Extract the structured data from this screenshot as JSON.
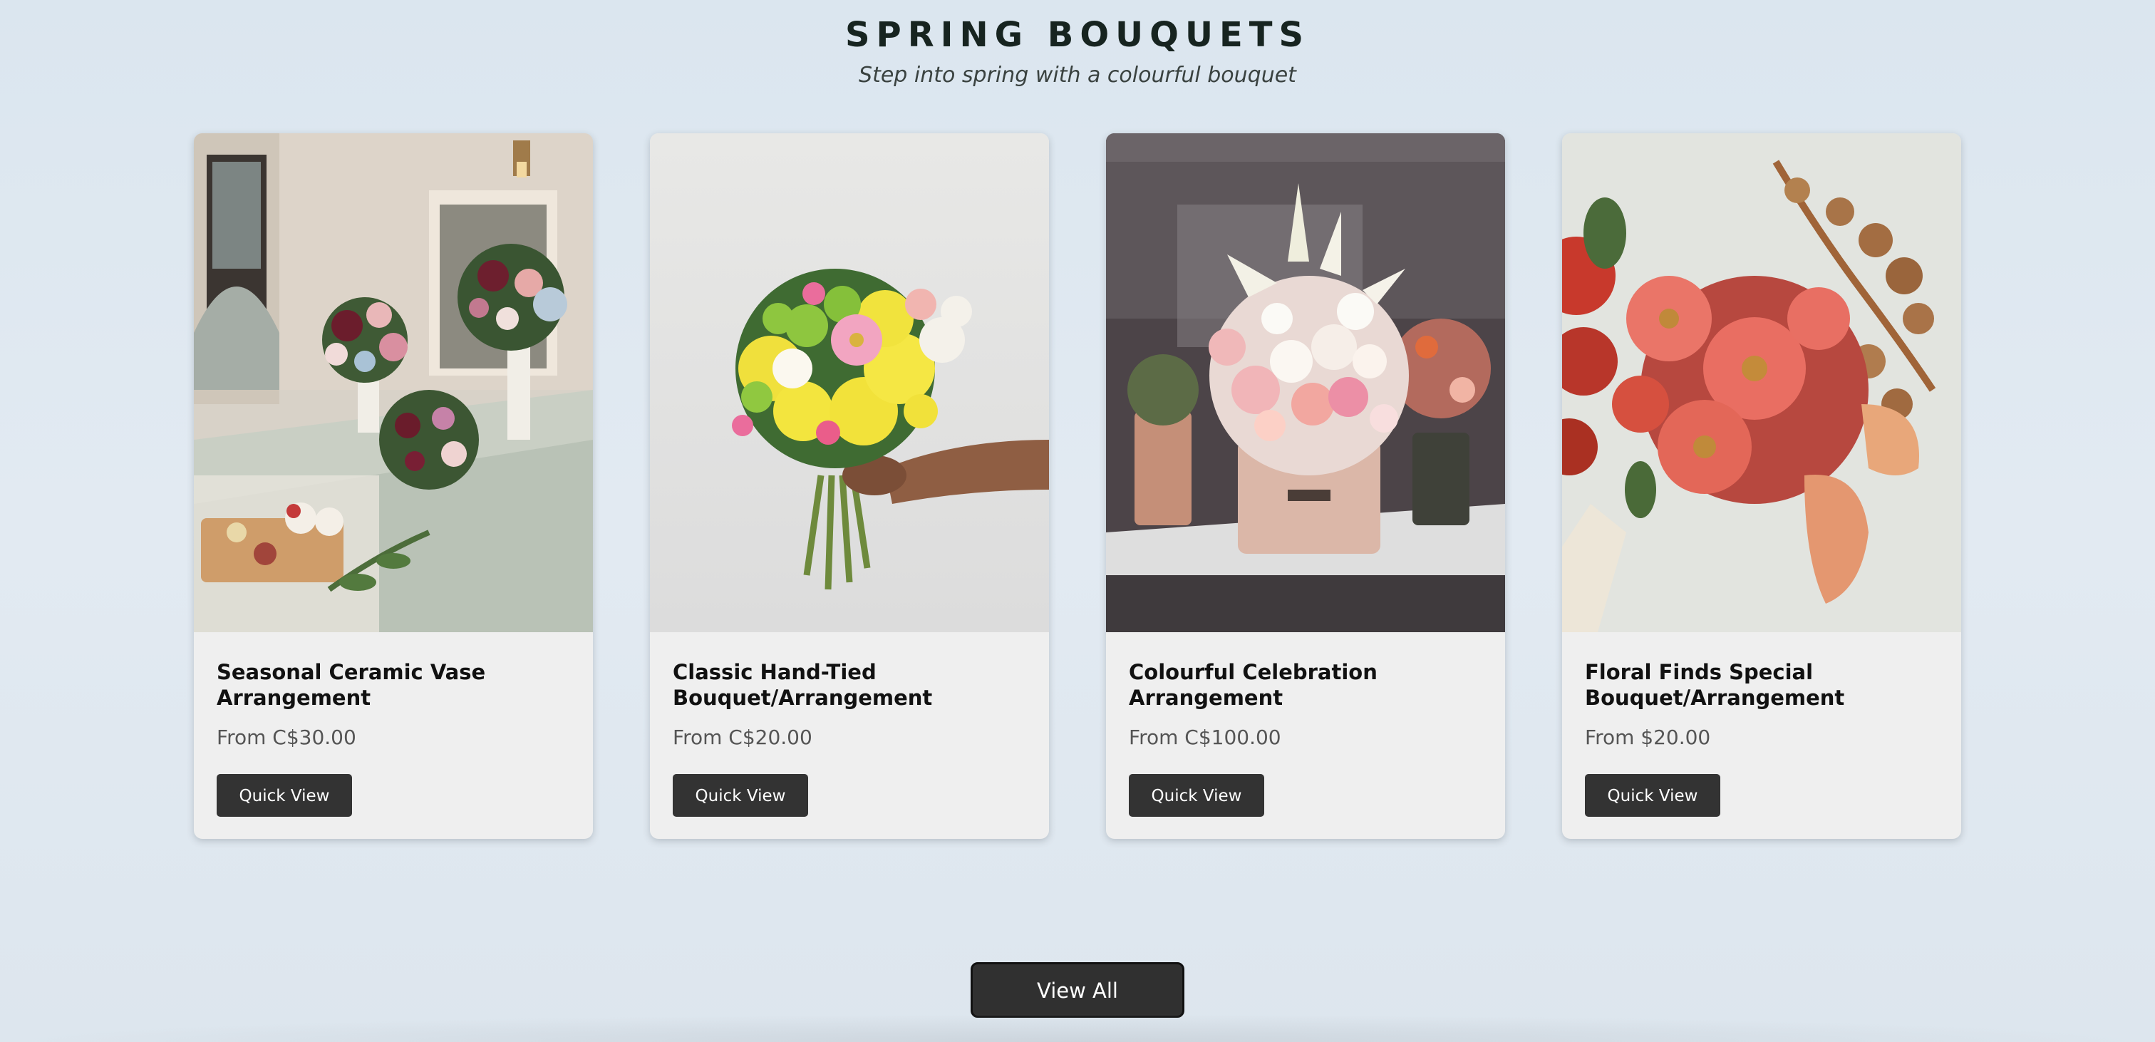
{
  "section": {
    "title": "SPRING BOUQUETS",
    "subtitle": "Step into spring with a colourful bouquet"
  },
  "products": [
    {
      "name": "Seasonal Ceramic Vase Arrangement",
      "price": "From C$30.00",
      "quick_view_label": "Quick View",
      "image_alt": "table-centerpiece-photo"
    },
    {
      "name": "Classic Hand-Tied Bouquet/Arrangement",
      "price": "From C$20.00",
      "quick_view_label": "Quick View",
      "image_alt": "hand-held-bouquet-photo"
    },
    {
      "name": "Colourful Celebration Arrangement",
      "price": "From C$100.00",
      "quick_view_label": "Quick View",
      "image_alt": "hatbox-arrangement-photo"
    },
    {
      "name": "Floral Finds Special Bouquet/Arrangement",
      "price": "From $20.00",
      "quick_view_label": "Quick View",
      "image_alt": "zinnia-bouquet-photo"
    }
  ],
  "view_all_label": "View All",
  "colors": {
    "background": "#dfe8f0",
    "card_background": "#efefef",
    "button_background": "#333333",
    "button_text": "#ffffff",
    "title_text": "#172420"
  }
}
